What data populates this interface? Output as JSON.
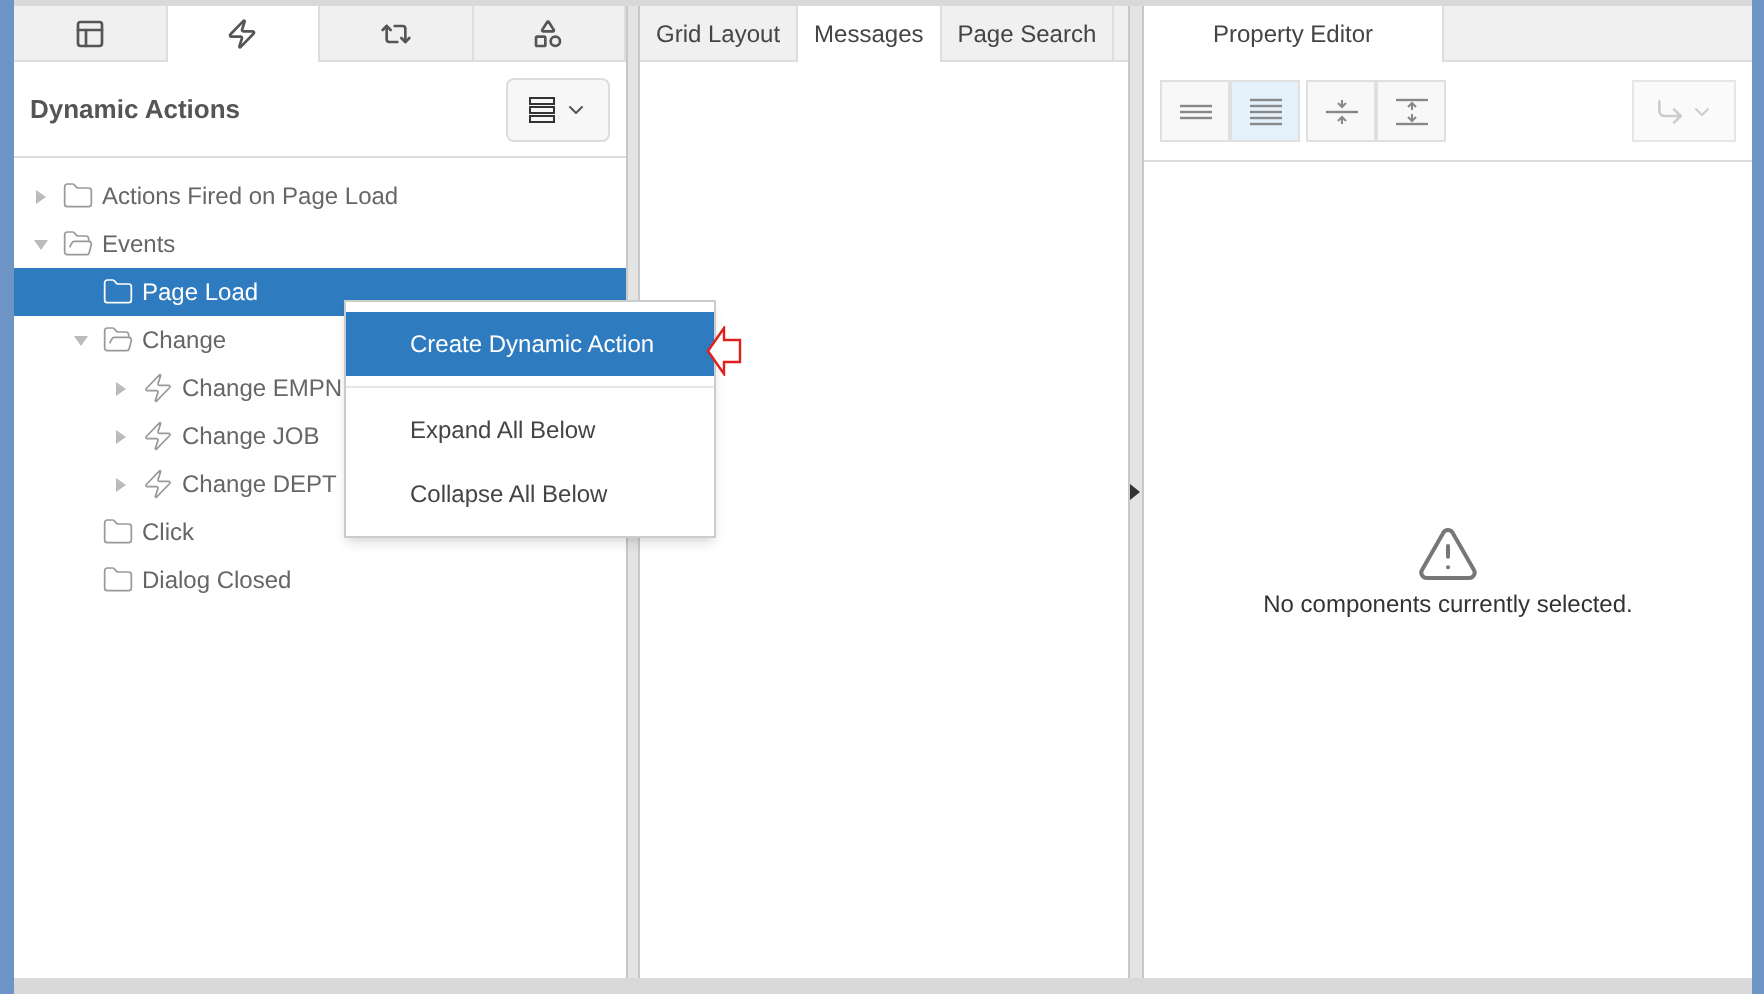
{
  "left_panel": {
    "tabs": [
      {
        "selected": false
      },
      {
        "selected": true
      },
      {
        "selected": false
      },
      {
        "selected": false
      }
    ],
    "title": "Dynamic Actions",
    "tree": [
      {
        "label": "Actions Fired on Page Load",
        "kind": "folder",
        "expanded": false,
        "selected": false
      },
      {
        "label": "Events",
        "kind": "folder",
        "expanded": true,
        "selected": false,
        "children": [
          {
            "label": "Page Load",
            "kind": "folder",
            "selected": true
          },
          {
            "label": "Change",
            "kind": "folder",
            "expanded": true,
            "selected": false,
            "children": [
              {
                "label": "Change EMPN",
                "kind": "event",
                "expanded": false,
                "selected": false
              },
              {
                "label": "Change JOB",
                "kind": "event",
                "expanded": false,
                "selected": false
              },
              {
                "label": "Change DEPT",
                "kind": "event",
                "expanded": false,
                "selected": false
              }
            ]
          },
          {
            "label": "Click",
            "kind": "folder",
            "selected": false
          },
          {
            "label": "Dialog Closed",
            "kind": "folder",
            "selected": false
          }
        ]
      }
    ],
    "context_menu": [
      {
        "label": "Create Dynamic Action",
        "selected": true
      },
      {
        "label": "Expand All Below",
        "selected": false
      },
      {
        "label": "Collapse All Below",
        "selected": false
      }
    ]
  },
  "middle_panel": {
    "tabs": [
      {
        "label": "Grid Layout",
        "selected": false
      },
      {
        "label": "Messages",
        "selected": true
      },
      {
        "label": "Page Search",
        "selected": false
      }
    ]
  },
  "right_panel": {
    "tabs": [
      {
        "label": "Property Editor",
        "selected": true
      }
    ],
    "toolbar": [
      {
        "selected": false
      },
      {
        "selected": true
      },
      {
        "selected": false
      },
      {
        "selected": false
      }
    ],
    "message": "No components currently selected."
  }
}
